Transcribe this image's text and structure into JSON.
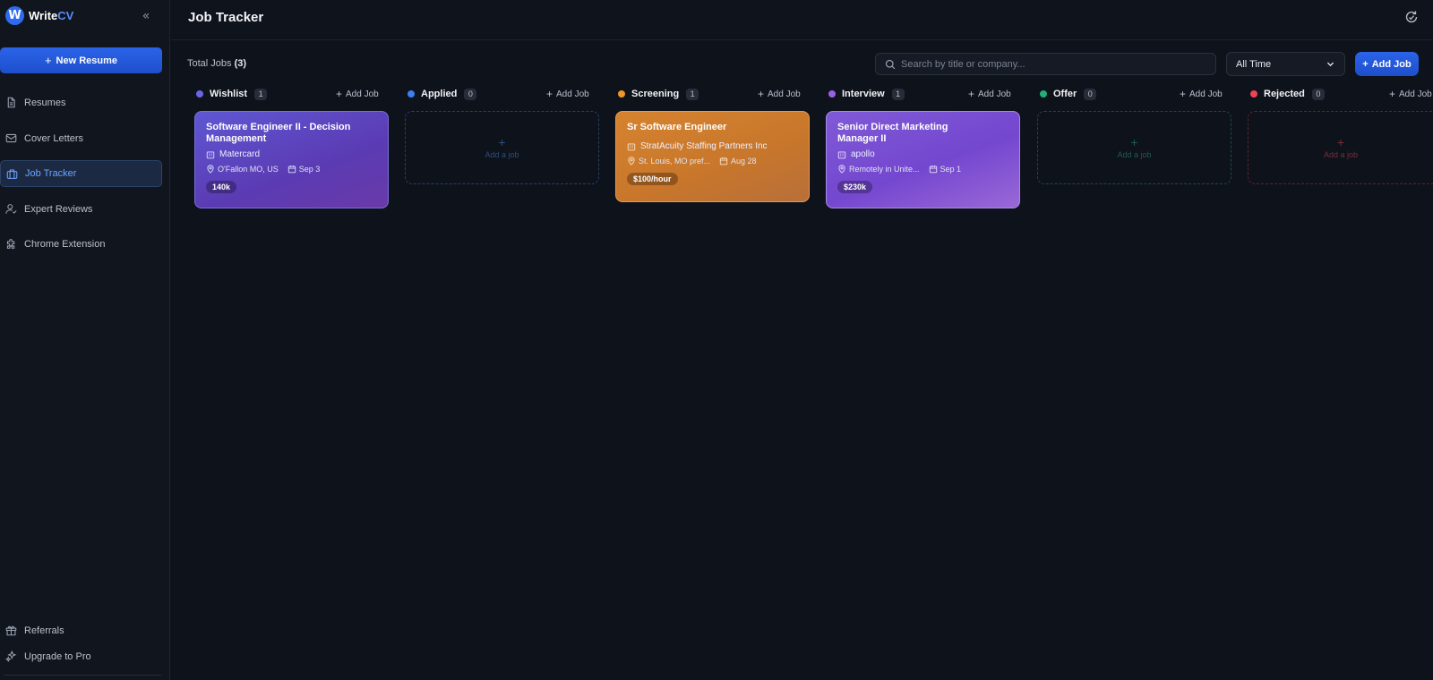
{
  "app": {
    "logo_letter": "W",
    "logo_name": "Write",
    "logo_accent": "CV"
  },
  "sidebar": {
    "new_resume": "New Resume",
    "items": [
      {
        "label": "Resumes",
        "icon": "file-icon"
      },
      {
        "label": "Cover Letters",
        "icon": "mail-icon"
      },
      {
        "label": "Job Tracker",
        "icon": "briefcase-icon",
        "active": true
      },
      {
        "label": "Expert Reviews",
        "icon": "user-check-icon"
      },
      {
        "label": "Chrome Extension",
        "icon": "puzzle-icon"
      }
    ],
    "bottom": [
      {
        "label": "Referrals",
        "icon": "gift-icon"
      },
      {
        "label": "Upgrade to Pro",
        "icon": "sparkles-icon"
      }
    ]
  },
  "header": {
    "title": "Job Tracker"
  },
  "toolbar": {
    "total_label": "Total Jobs",
    "total_count": "(3)",
    "search_placeholder": "Search by title or company...",
    "filter_value": "All Time",
    "add_job": "Add Job"
  },
  "columns": [
    {
      "name": "Wishlist",
      "count": "1",
      "color": "#6b63e8",
      "add": "Add Job"
    },
    {
      "name": "Applied",
      "count": "0",
      "color": "#3d7ff0",
      "add": "Add Job",
      "empty": "Add a job"
    },
    {
      "name": "Screening",
      "count": "1",
      "color": "#f0962a",
      "add": "Add Job"
    },
    {
      "name": "Interview",
      "count": "1",
      "color": "#9a5fe8",
      "add": "Add Job"
    },
    {
      "name": "Offer",
      "count": "0",
      "color": "#21b07a",
      "add": "Add Job",
      "empty": "Add a job"
    },
    {
      "name": "Rejected",
      "count": "0",
      "color": "#ef4455",
      "add": "Add Job",
      "empty": "Add a job"
    }
  ],
  "cards": {
    "wishlist": {
      "title": "Software Engineer II - Decision Management",
      "company": "Matercard",
      "location": "O'Fallon MO, US",
      "date": "Sep 3",
      "salary": "140k"
    },
    "screening": {
      "title": "Sr Software Engineer",
      "company": "StratAcuity Staffing Partners Inc",
      "location": "St. Louis, MO pref...",
      "date": "Aug 28",
      "salary": "$100/hour"
    },
    "interview": {
      "title": "Senior Direct Marketing Manager II",
      "company": "apollo",
      "location": "Remotely in Unite...",
      "date": "Sep 1",
      "salary": "$230k"
    }
  }
}
